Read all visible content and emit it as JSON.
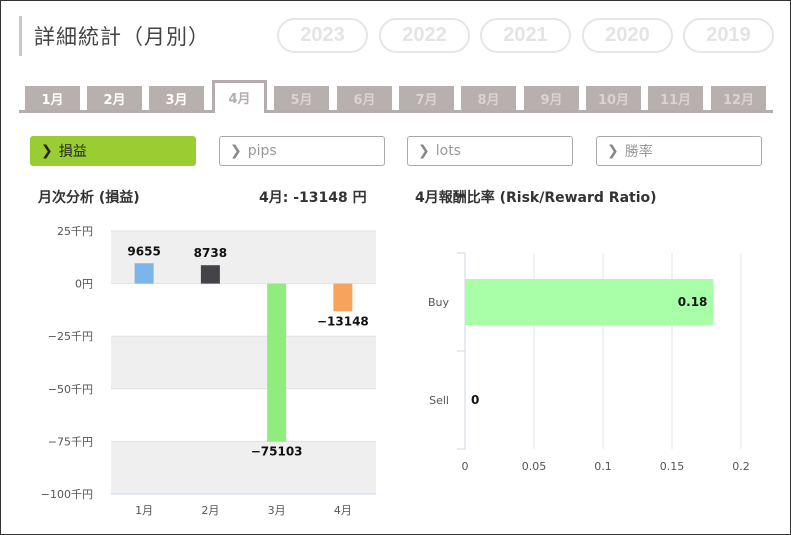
{
  "page": {
    "title": "詳細統計（月別）"
  },
  "years": [
    {
      "label": "2023",
      "active": true
    },
    {
      "label": "2022",
      "active": false
    },
    {
      "label": "2021",
      "active": false
    },
    {
      "label": "2020",
      "active": false
    },
    {
      "label": "2019",
      "active": false
    }
  ],
  "months": [
    {
      "label": "1月",
      "state": "normal"
    },
    {
      "label": "2月",
      "state": "normal"
    },
    {
      "label": "3月",
      "state": "normal"
    },
    {
      "label": "4月",
      "state": "active"
    },
    {
      "label": "5月",
      "state": "inactive"
    },
    {
      "label": "6月",
      "state": "inactive"
    },
    {
      "label": "7月",
      "state": "inactive"
    },
    {
      "label": "8月",
      "state": "inactive"
    },
    {
      "label": "9月",
      "state": "inactive"
    },
    {
      "label": "10月",
      "state": "inactive"
    },
    {
      "label": "11月",
      "state": "inactive"
    },
    {
      "label": "12月",
      "state": "inactive"
    }
  ],
  "metrics": [
    {
      "label": "損益",
      "active": true
    },
    {
      "label": "pips",
      "active": false
    },
    {
      "label": "lots",
      "active": false
    },
    {
      "label": "勝率",
      "active": false
    }
  ],
  "monthly_section": {
    "title": "月次分析 (損益)",
    "summary": "4月:  -13148 円"
  },
  "rr_section": {
    "title": "4月報酬比率 (Risk/Reward Ratio)"
  },
  "colors": {
    "accent_year": "#fb8a10",
    "accent_metric": "#9acd32"
  },
  "chart_data": [
    {
      "type": "bar",
      "categories": [
        "1月",
        "2月",
        "3月",
        "4月"
      ],
      "values": [
        9655,
        8738,
        -75103,
        -13148
      ],
      "value_labels": [
        "9655",
        "8738",
        "-75103",
        "-13148"
      ],
      "bar_colors": [
        "#7cb5ec",
        "#434348",
        "#90ed7d",
        "#f7a35c"
      ],
      "ylim": [
        -100000,
        25000
      ],
      "y_ticks": [
        25000,
        0,
        -25000,
        -50000,
        -75000,
        -100000
      ],
      "y_tick_labels": [
        "25千円",
        "0円",
        "−25千円",
        "−50千円",
        "−75千円",
        "−100千円"
      ],
      "grid_bands": true
    },
    {
      "type": "bar",
      "orientation": "horizontal",
      "categories": [
        "Buy",
        "Sell"
      ],
      "values": [
        0.18,
        0
      ],
      "value_labels": [
        "0.18",
        "0"
      ],
      "bar_color": "#a8ffa8",
      "xlim": [
        0,
        0.2
      ],
      "x_ticks": [
        0,
        0.05,
        0.1,
        0.15,
        0.2
      ],
      "x_tick_labels": [
        "0",
        "0.05",
        "0.1",
        "0.15",
        "0.2"
      ],
      "grid": true
    }
  ]
}
